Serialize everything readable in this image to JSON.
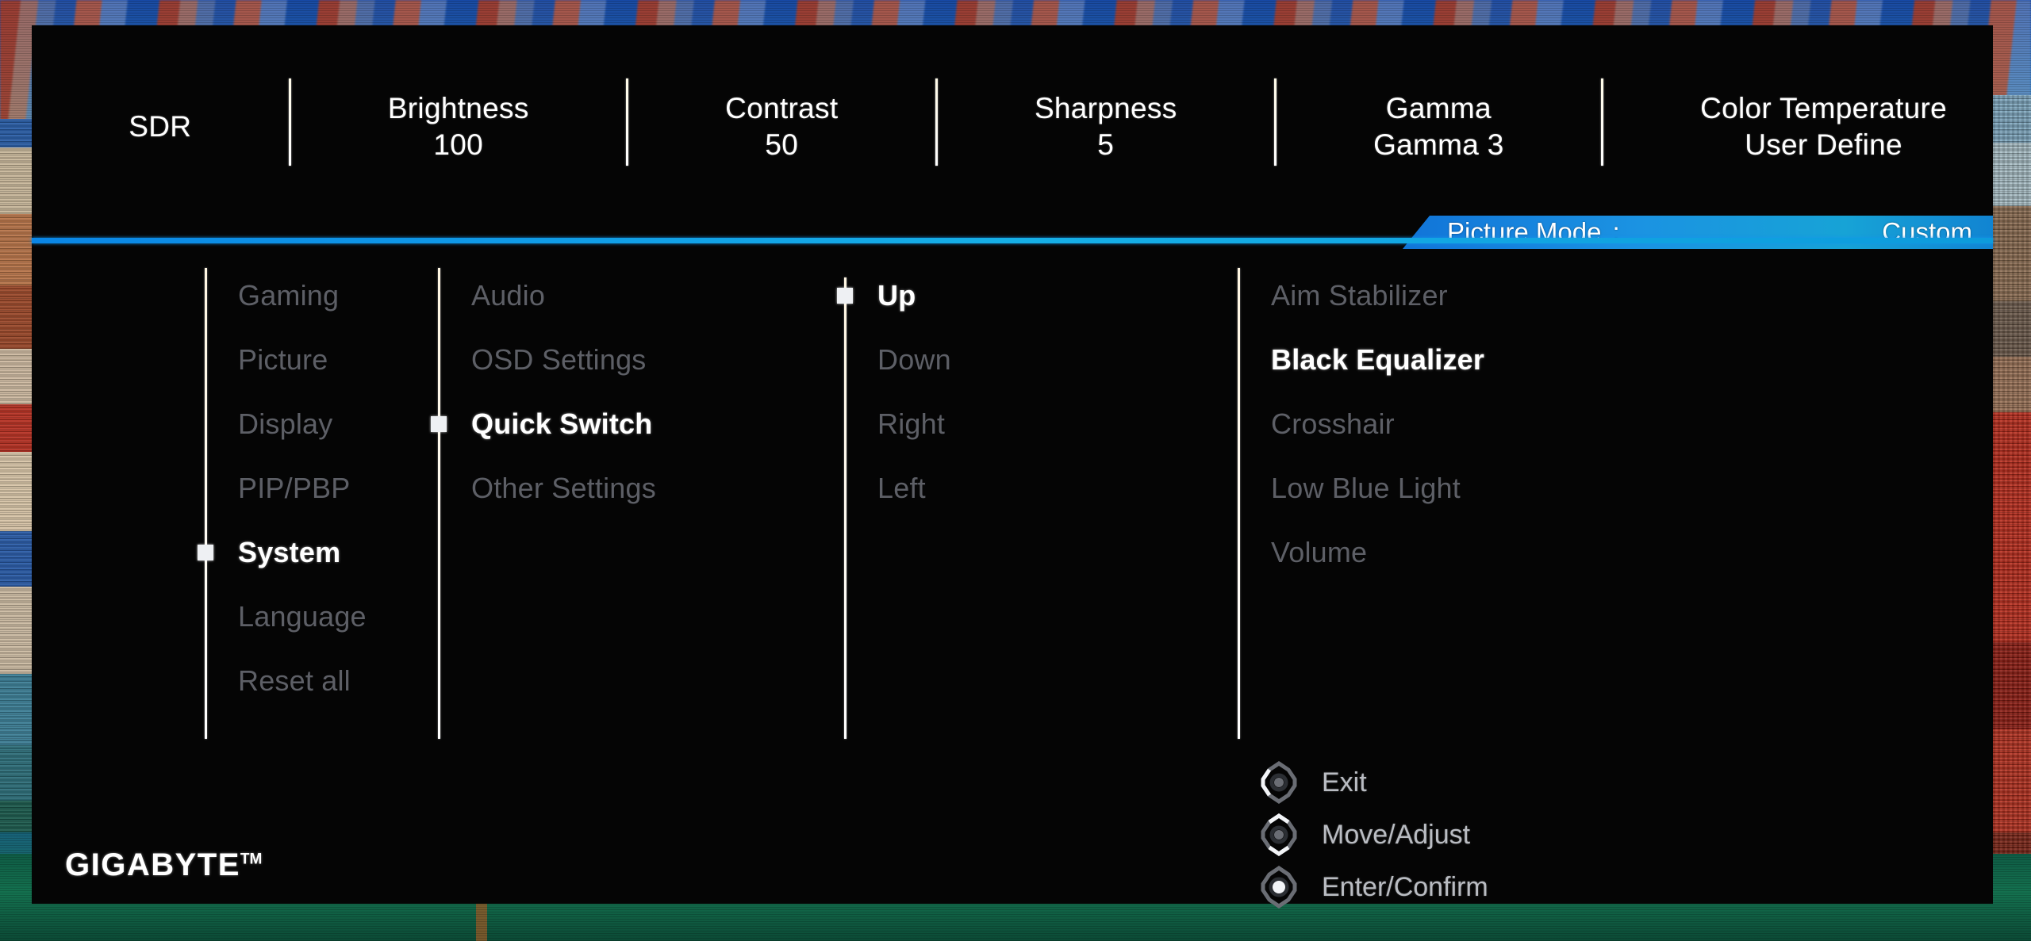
{
  "background": {
    "description": "photo of wooden boats on blue-green water"
  },
  "scrollbar": {
    "name": "vertical-scrollbar"
  },
  "topbar": {
    "items": [
      {
        "label": "SDR",
        "value": ""
      },
      {
        "label": "Brightness",
        "value": "100"
      },
      {
        "label": "Contrast",
        "value": "50"
      },
      {
        "label": "Sharpness",
        "value": "5"
      },
      {
        "label": "Gamma",
        "value": "Gamma 3"
      },
      {
        "label": "Color Temperature",
        "value": "User Define"
      }
    ]
  },
  "ribbon": {
    "label": "Picture Mode",
    "colon": ":",
    "value": "Custom",
    "color": "#1b93e2"
  },
  "columns": [
    {
      "name": "main-menu",
      "items": [
        {
          "label": "Gaming",
          "state": "dim",
          "marked": false
        },
        {
          "label": "Picture",
          "state": "dim",
          "marked": false
        },
        {
          "label": "Display",
          "state": "dim",
          "marked": false
        },
        {
          "label": "PIP/PBP",
          "state": "dim",
          "marked": false
        },
        {
          "label": "System",
          "state": "selected",
          "marked": true
        },
        {
          "label": "Language",
          "state": "dim",
          "marked": false
        },
        {
          "label": "Reset all",
          "state": "dim",
          "marked": false
        }
      ]
    },
    {
      "name": "system-submenu",
      "items": [
        {
          "label": "Audio",
          "state": "dim",
          "marked": false
        },
        {
          "label": "OSD Settings",
          "state": "dim",
          "marked": false
        },
        {
          "label": "Quick Switch",
          "state": "selected",
          "marked": true
        },
        {
          "label": "Other Settings",
          "state": "dim",
          "marked": false
        }
      ]
    },
    {
      "name": "quick-switch-directions",
      "items": [
        {
          "label": "Up",
          "state": "selected",
          "marked": true
        },
        {
          "label": "Down",
          "state": "dim",
          "marked": false
        },
        {
          "label": "Right",
          "state": "dim",
          "marked": false
        },
        {
          "label": "Left",
          "state": "dim",
          "marked": false
        }
      ]
    },
    {
      "name": "up-assignment-options",
      "items": [
        {
          "label": "Aim Stabilizer",
          "state": "dim",
          "marked": false
        },
        {
          "label": "Black Equalizer",
          "state": "selected",
          "marked": false
        },
        {
          "label": "Crosshair",
          "state": "dim",
          "marked": false
        },
        {
          "label": "Low Blue Light",
          "state": "dim",
          "marked": false
        },
        {
          "label": "Volume",
          "state": "dim",
          "marked": false
        }
      ]
    }
  ],
  "hints": [
    {
      "icon": "joystick-left-icon",
      "label": "Exit"
    },
    {
      "icon": "joystick-updown-icon",
      "label": "Move/Adjust"
    },
    {
      "icon": "joystick-press-icon",
      "label": "Enter/Confirm"
    }
  ],
  "brand": {
    "name": "GIGABYTE",
    "tm": "TM"
  }
}
